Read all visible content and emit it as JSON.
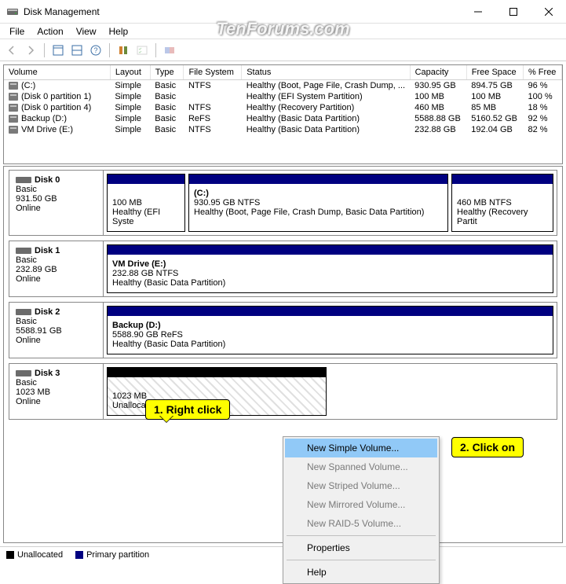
{
  "window": {
    "title": "Disk Management"
  },
  "menus": {
    "file": "File",
    "action": "Action",
    "view": "View",
    "help": "Help"
  },
  "watermark": "TenForums.com",
  "table": {
    "headers": {
      "volume": "Volume",
      "layout": "Layout",
      "type": "Type",
      "fs": "File System",
      "status": "Status",
      "capacity": "Capacity",
      "free": "Free Space",
      "pct": "% Free"
    },
    "rows": [
      {
        "volume": "(C:)",
        "layout": "Simple",
        "type": "Basic",
        "fs": "NTFS",
        "status": "Healthy (Boot, Page File, Crash Dump, ...",
        "capacity": "930.95 GB",
        "free": "894.75 GB",
        "pct": "96 %"
      },
      {
        "volume": "(Disk 0 partition 1)",
        "layout": "Simple",
        "type": "Basic",
        "fs": "",
        "status": "Healthy (EFI System Partition)",
        "capacity": "100 MB",
        "free": "100 MB",
        "pct": "100 %"
      },
      {
        "volume": "(Disk 0 partition 4)",
        "layout": "Simple",
        "type": "Basic",
        "fs": "NTFS",
        "status": "Healthy (Recovery Partition)",
        "capacity": "460 MB",
        "free": "85 MB",
        "pct": "18 %"
      },
      {
        "volume": "Backup (D:)",
        "layout": "Simple",
        "type": "Basic",
        "fs": "ReFS",
        "status": "Healthy (Basic Data Partition)",
        "capacity": "5588.88 GB",
        "free": "5160.52 GB",
        "pct": "92 %"
      },
      {
        "volume": "VM Drive (E:)",
        "layout": "Simple",
        "type": "Basic",
        "fs": "NTFS",
        "status": "Healthy (Basic Data Partition)",
        "capacity": "232.88 GB",
        "free": "192.04 GB",
        "pct": "82 %"
      }
    ]
  },
  "disks": {
    "d0": {
      "name": "Disk 0",
      "type": "Basic",
      "size": "931.50 GB",
      "status": "Online",
      "p0": {
        "line1": "100 MB",
        "line2": "Healthy (EFI Syste"
      },
      "p1": {
        "label": "(C:)",
        "line1": "930.95 GB NTFS",
        "line2": "Healthy (Boot, Page File, Crash Dump, Basic Data Partition)"
      },
      "p2": {
        "line1": "460 MB NTFS",
        "line2": "Healthy (Recovery Partit"
      }
    },
    "d1": {
      "name": "Disk 1",
      "type": "Basic",
      "size": "232.89 GB",
      "status": "Online",
      "p0": {
        "label": "VM Drive  (E:)",
        "line1": "232.88 GB NTFS",
        "line2": "Healthy (Basic Data Partition)"
      }
    },
    "d2": {
      "name": "Disk 2",
      "type": "Basic",
      "size": "5588.91 GB",
      "status": "Online",
      "p0": {
        "label": "Backup  (D:)",
        "line1": "5588.90 GB ReFS",
        "line2": "Healthy (Basic Data Partition)"
      }
    },
    "d3": {
      "name": "Disk 3",
      "type": "Basic",
      "size": "1023 MB",
      "status": "Online",
      "p0": {
        "line1": "1023 MB",
        "line2": "Unallocated"
      }
    }
  },
  "legend": {
    "unallocated": "Unallocated",
    "primary": "Primary partition"
  },
  "context": {
    "simple": "New Simple Volume...",
    "spanned": "New Spanned Volume...",
    "striped": "New Striped Volume...",
    "mirrored": "New Mirrored Volume...",
    "raid5": "New RAID-5 Volume...",
    "properties": "Properties",
    "help": "Help"
  },
  "callouts": {
    "c1": "1. Right click",
    "c2": "2. Click on"
  },
  "colors": {
    "primary": "#000080",
    "unallocated": "#000000",
    "highlight": "#91c9f7",
    "callout": "#ffff00"
  }
}
